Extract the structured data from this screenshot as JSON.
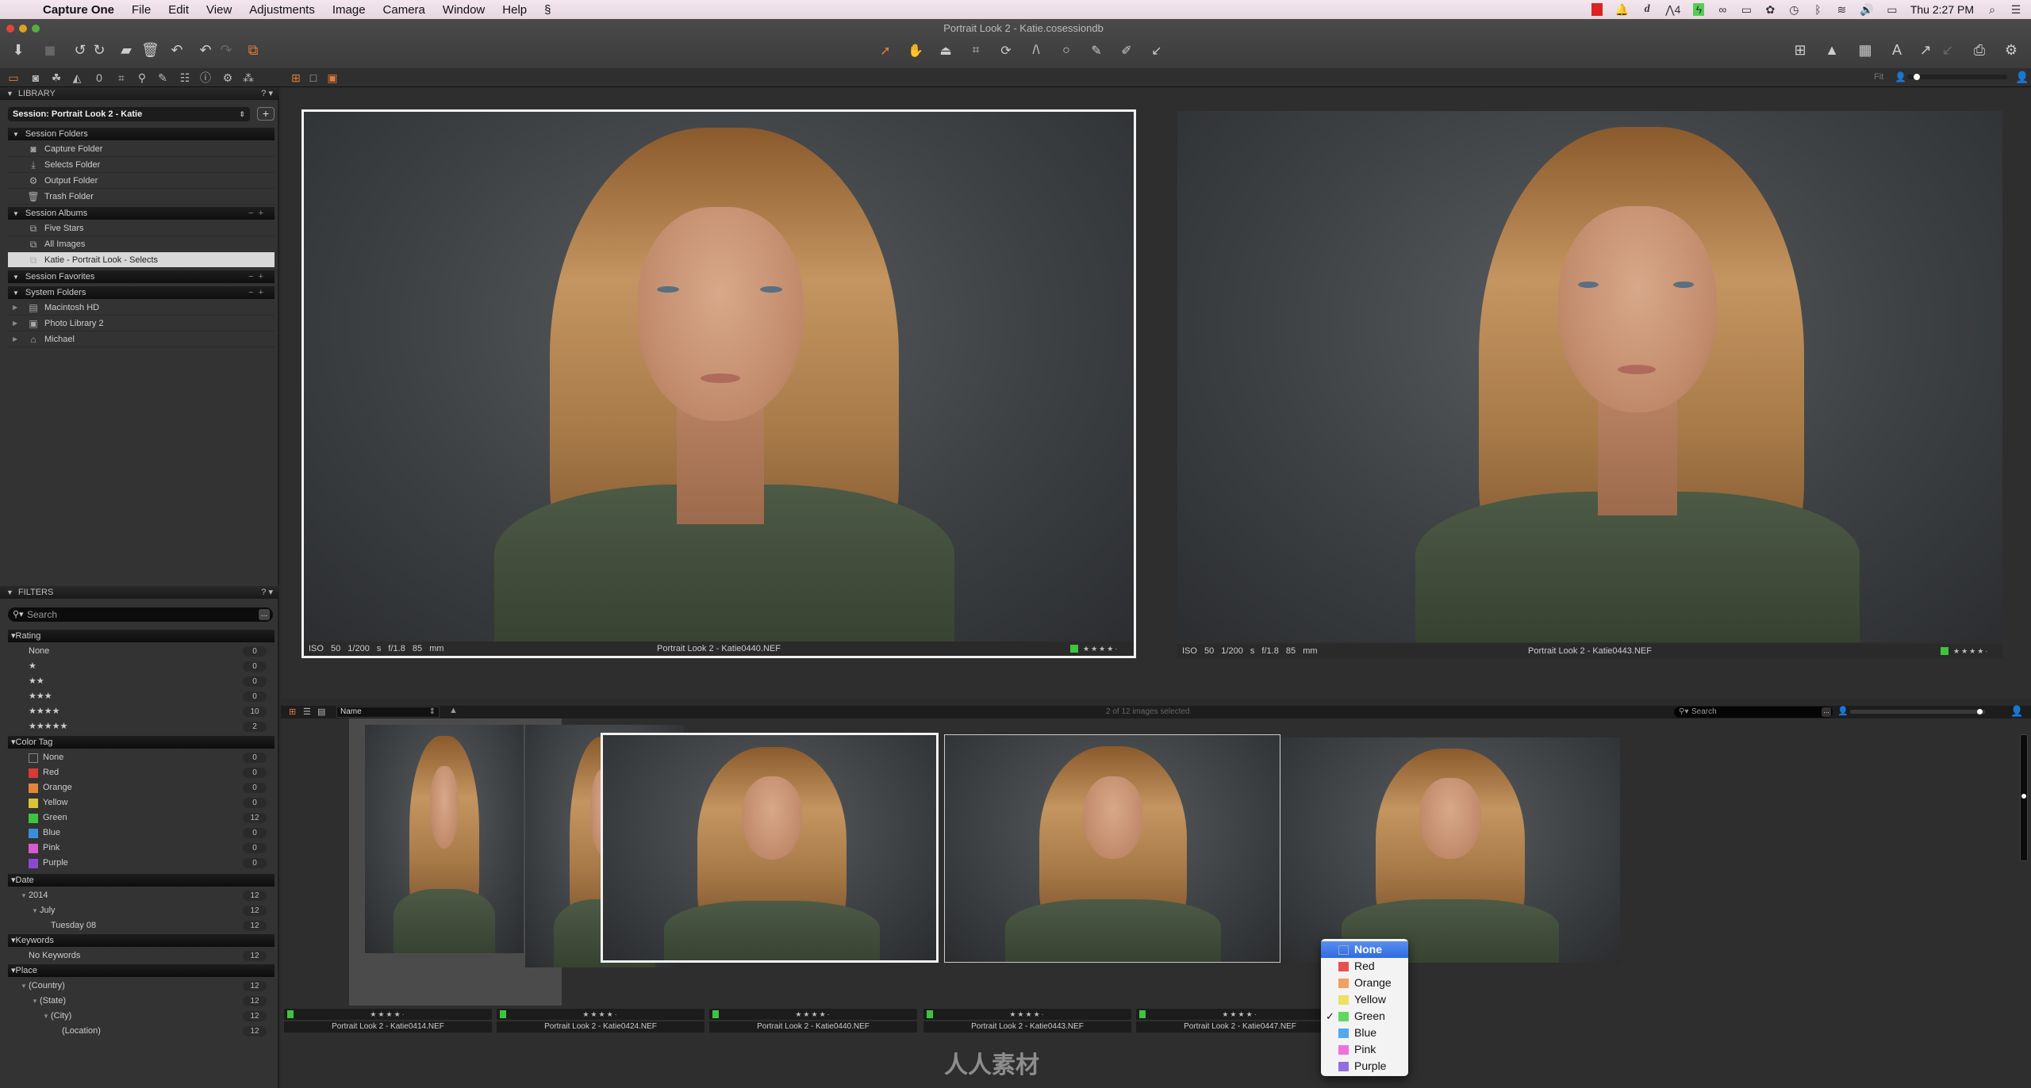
{
  "menubar": {
    "app_name": "Capture One",
    "items": [
      "File",
      "Edit",
      "View",
      "Adjustments",
      "Image",
      "Camera",
      "Window",
      "Help"
    ],
    "tray_icons": [
      "screen-recorder-icon",
      "notification-icon",
      "dictionary-icon",
      "adobe-icon",
      "evernote-icon",
      "creative-cloud-icon",
      "display-icon",
      "sync-icon",
      "time-machine-icon",
      "bluetooth-icon",
      "wifi-icon",
      "volume-icon",
      "battery-icon"
    ],
    "tray_badge": "4",
    "clock": "Thu 2:27 PM"
  },
  "window": {
    "title": "Portrait Look 2 - Katie.cosessiondb"
  },
  "toolbar": {
    "left_buttons": [
      "import-icon",
      "camera-icon",
      "rotate-left-icon",
      "rotate-right-icon",
      "move-to-selects-icon",
      "trash-icon",
      "undo-icon",
      "undo2-icon",
      "redo-icon",
      "variants-icon"
    ],
    "cursor_tools": [
      "select-cursor-icon",
      "pan-icon",
      "loupe-icon",
      "crop-icon",
      "rotate-icon",
      "keystone-icon",
      "spot-removal-icon",
      "brush-icon",
      "eyedropper-icon",
      "arrow-icon"
    ],
    "right_buttons": [
      "grid-icon",
      "exposure-warning-icon",
      "overlay-grid-icon",
      "text-icon",
      "copy-adjustments-icon",
      "apply-adjustments-icon",
      "print-icon",
      "settings-icon"
    ]
  },
  "tool_tabs": [
    "library-tab",
    "capture-tab",
    "color-tab",
    "exposure-tab",
    "lens-tab",
    "composition-tab",
    "details-tab",
    "adjustments-tab",
    "metadata-tab",
    "output-tab",
    "batch-tab",
    "settings-tab"
  ],
  "viewer_mode_buttons": [
    "multi-view",
    "single-view",
    "primary-view"
  ],
  "zoom": {
    "label": "Fit",
    "level": 0.05
  },
  "library": {
    "title": "LIBRARY",
    "help": "?",
    "session_select": "Session: Portrait Look 2 - Katie",
    "session_folders": {
      "title": "Session Folders",
      "items": [
        {
          "label": "Capture Folder",
          "icon": "camera-folder-icon"
        },
        {
          "label": "Selects Folder",
          "icon": "selects-folder-icon"
        },
        {
          "label": "Output Folder",
          "icon": "output-gear-icon"
        },
        {
          "label": "Trash Folder",
          "icon": "trash-icon"
        }
      ]
    },
    "session_albums": {
      "title": "Session Albums",
      "items": [
        {
          "label": "Five Stars"
        },
        {
          "label": "All Images"
        },
        {
          "label": "Katie - Portrait Look - Selects",
          "selected": true
        }
      ]
    },
    "session_favorites": {
      "title": "Session Favorites"
    },
    "system_folders": {
      "title": "System Folders",
      "items": [
        {
          "label": "Macintosh HD",
          "icon": "hard-drive-icon"
        },
        {
          "label": "Photo Library 2",
          "icon": "photo-library-icon"
        },
        {
          "label": "Michael",
          "icon": "home-icon"
        }
      ]
    }
  },
  "filters": {
    "title": "FILTERS",
    "help": "?",
    "search_placeholder": "Search",
    "rating": {
      "title": "Rating",
      "items": [
        {
          "label": "None",
          "count": "0"
        },
        {
          "label": "★",
          "count": "0"
        },
        {
          "label": "★★",
          "count": "0"
        },
        {
          "label": "★★★",
          "count": "0"
        },
        {
          "label": "★★★★",
          "count": "10"
        },
        {
          "label": "★★★★★",
          "count": "2"
        }
      ]
    },
    "color_tag": {
      "title": "Color Tag",
      "items": [
        {
          "label": "None",
          "count": "0",
          "color": "transparent"
        },
        {
          "label": "Red",
          "count": "0",
          "color": "#d83a34"
        },
        {
          "label": "Orange",
          "count": "0",
          "color": "#e0863a"
        },
        {
          "label": "Yellow",
          "count": "0",
          "color": "#d8c43a"
        },
        {
          "label": "Green",
          "count": "12",
          "color": "#3ec43e"
        },
        {
          "label": "Blue",
          "count": "0",
          "color": "#3a8ed8"
        },
        {
          "label": "Pink",
          "count": "0",
          "color": "#d85ad0"
        },
        {
          "label": "Purple",
          "count": "0",
          "color": "#8a4ad0"
        }
      ]
    },
    "date": {
      "title": "Date",
      "items": [
        {
          "label": "2014",
          "count": "12",
          "level": 1
        },
        {
          "label": "July",
          "count": "12",
          "level": 2
        },
        {
          "label": "Tuesday 08",
          "count": "12",
          "level": 3
        }
      ]
    },
    "keywords": {
      "title": "Keywords",
      "items": [
        {
          "label": "No Keywords",
          "count": "12"
        }
      ]
    },
    "place": {
      "title": "Place",
      "items": [
        {
          "label": "(Country)",
          "count": "12",
          "level": 1
        },
        {
          "label": "(State)",
          "count": "12",
          "level": 2
        },
        {
          "label": "(City)",
          "count": "12",
          "level": 3
        },
        {
          "label": "(Location)",
          "count": "12",
          "level": 4
        }
      ]
    }
  },
  "viewer": {
    "images": [
      {
        "exif": "ISO 50   1/200 s   f/1.8   85 mm",
        "name": "Portrait Look 2 - Katie0440.NEF",
        "stars": "★★★★·",
        "tag_color": "#3ec43e",
        "selected": true
      },
      {
        "exif": "ISO 50   1/200 s   f/1.8   85 mm",
        "name": "Portrait Look 2 - Katie0443.NEF",
        "stars": "★★★★·",
        "tag_color": "#3ec43e",
        "selected": false
      }
    ]
  },
  "browser": {
    "sort_label": "Name",
    "selection_status": "2 of 12 images selected",
    "search_placeholder": "Search",
    "thumb_size": 0.5,
    "thumbnails": [
      {
        "name": "Portrait Look 2 - Katie0414.NEF",
        "stars": "★★★★·",
        "tag_color": "#3ec43e"
      },
      {
        "name": "Portrait Look 2 - Katie0424.NEF",
        "stars": "★★★★·",
        "tag_color": "#3ec43e"
      },
      {
        "name": "Portrait Look 2 - Katie0440.NEF",
        "stars": "★★★★·",
        "tag_color": "#3ec43e"
      },
      {
        "name": "Portrait Look 2 - Katie0443.NEF",
        "stars": "★★★★·",
        "tag_color": "#3ec43e"
      },
      {
        "name": "Portrait Look 2 - Katie0447.NEF",
        "stars": "★★★★·",
        "tag_color": "#3ec43e"
      }
    ]
  },
  "color_menu": {
    "items": [
      {
        "label": "None",
        "color": "transparent",
        "highlighted": true,
        "checked": false
      },
      {
        "label": "Red",
        "color": "#e85050",
        "highlighted": false,
        "checked": false
      },
      {
        "label": "Orange",
        "color": "#f0a060",
        "highlighted": false,
        "checked": false
      },
      {
        "label": "Yellow",
        "color": "#f0e060",
        "highlighted": false,
        "checked": false
      },
      {
        "label": "Green",
        "color": "#60d860",
        "highlighted": false,
        "checked": true
      },
      {
        "label": "Blue",
        "color": "#50a8f0",
        "highlighted": false,
        "checked": false
      },
      {
        "label": "Pink",
        "color": "#f070e0",
        "highlighted": false,
        "checked": false
      },
      {
        "label": "Purple",
        "color": "#9070e0",
        "highlighted": false,
        "checked": false
      }
    ],
    "check_glyph": "✓"
  },
  "watermark": "人人素材"
}
